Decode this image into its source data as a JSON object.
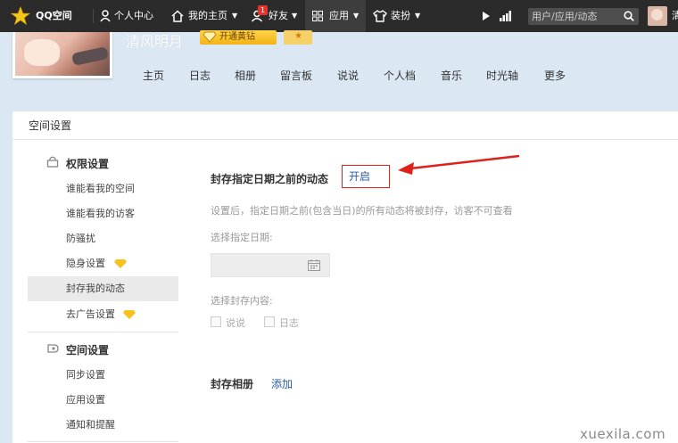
{
  "topbar": {
    "logo": "QQ空间",
    "personal_center": "个人中心",
    "my_home": "我的主页",
    "friends": "好友",
    "friends_badge": "1",
    "apps": "应用",
    "dress_up": "装扮",
    "search_placeholder": "用户/应用/动态",
    "extra": "清"
  },
  "profile": {
    "name": "清风明月",
    "vip_button": "开通黄钻"
  },
  "nav": [
    "主页",
    "日志",
    "相册",
    "留言板",
    "说说",
    "个人档",
    "音乐",
    "时光轴",
    "更多"
  ],
  "panel": {
    "title": "空间设置"
  },
  "sidebar": {
    "group1": "权限设置",
    "group1_items": [
      "谁能看我的空间",
      "谁能看我的访客",
      "防骚扰",
      "隐身设置",
      "封存我的动态",
      "去广告设置"
    ],
    "group2": "空间设置",
    "group2_items": [
      "同步设置",
      "应用设置",
      "通知和提醒"
    ]
  },
  "content": {
    "archive_label": "封存指定日期之前的动态",
    "open_button": "开启",
    "description": "设置后，指定日期之前(包含当日)的所有动态将被封存，访客不可查看",
    "select_date_label": "选择指定日期:",
    "select_content_label": "选择封存内容:",
    "option_shuoshuo": "说说",
    "option_rizhi": "日志",
    "album_label": "封存相册",
    "add_link": "添加"
  },
  "watermark": "xuexila.com"
}
